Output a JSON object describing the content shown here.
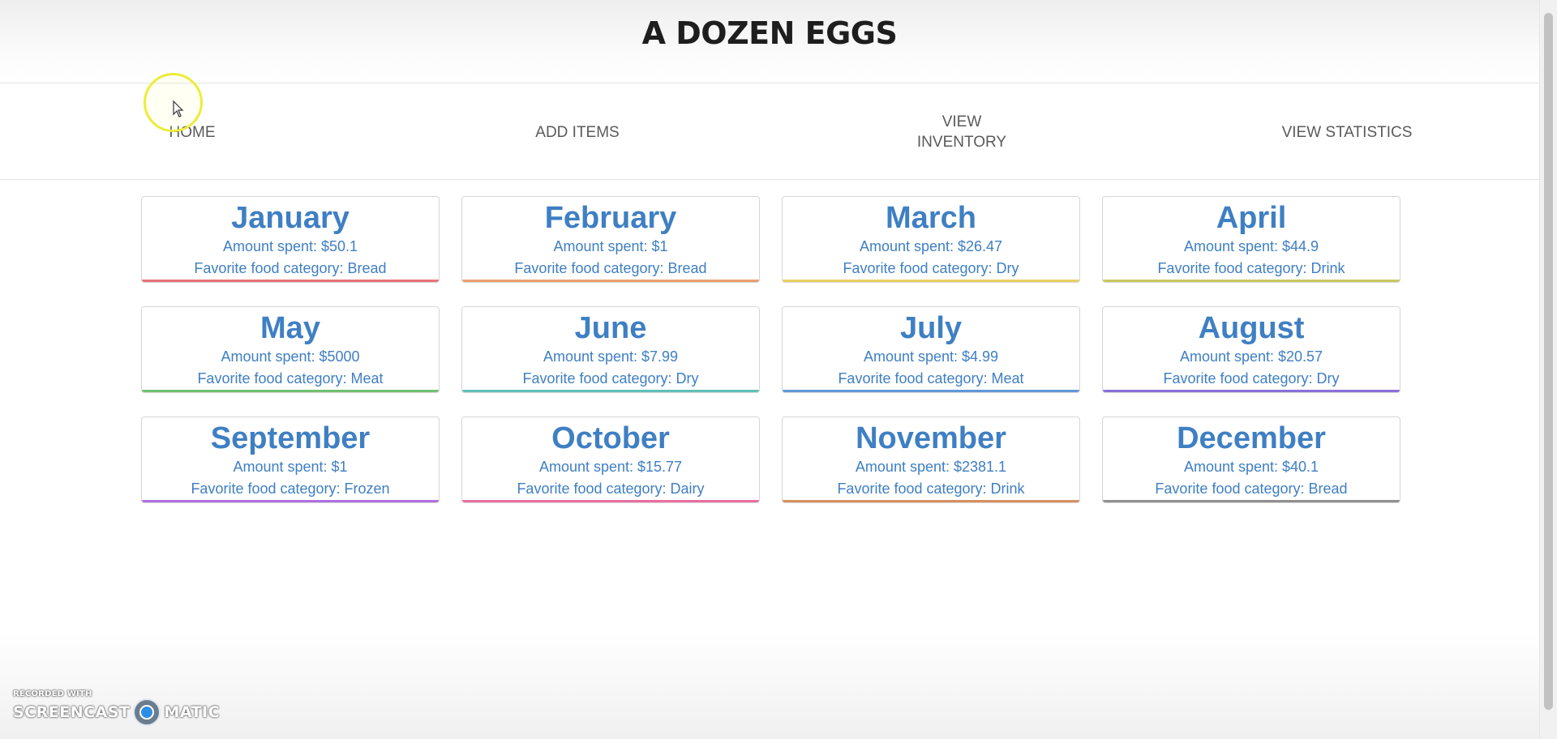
{
  "header": {
    "title": "A DOZEN EGGS"
  },
  "nav": {
    "home": "HOME",
    "add_items": "ADD ITEMS",
    "view_inventory": "VIEW INVENTORY",
    "view_statistics": "VIEW STATISTICS"
  },
  "months": [
    {
      "name": "January",
      "amount": "Amount spent: $50.1",
      "category": "Favorite food category: Bread",
      "accent": "#e8707a"
    },
    {
      "name": "February",
      "amount": "Amount spent: $1",
      "category": "Favorite food category: Bread",
      "accent": "#e8a070"
    },
    {
      "name": "March",
      "amount": "Amount spent: $26.47",
      "category": "Favorite food category: Dry",
      "accent": "#e8d060"
    },
    {
      "name": "April",
      "amount": "Amount spent: $44.9",
      "category": "Favorite food category: Drink",
      "accent": "#c8c860"
    },
    {
      "name": "May",
      "amount": "Amount spent: $5000",
      "category": "Favorite food category: Meat",
      "accent": "#70c070"
    },
    {
      "name": "June",
      "amount": "Amount spent: $7.99",
      "category": "Favorite food category: Dry",
      "accent": "#60c0b8"
    },
    {
      "name": "July",
      "amount": "Amount spent: $4.99",
      "category": "Favorite food category: Meat",
      "accent": "#6098d8"
    },
    {
      "name": "August",
      "amount": "Amount spent: $20.57",
      "category": "Favorite food category: Dry",
      "accent": "#8870d8"
    },
    {
      "name": "September",
      "amount": "Amount spent: $1",
      "category": "Favorite food category: Frozen",
      "accent": "#b070e0"
    },
    {
      "name": "October",
      "amount": "Amount spent: $15.77",
      "category": "Favorite food category: Dairy",
      "accent": "#e870a0"
    },
    {
      "name": "November",
      "amount": "Amount spent: $2381.1",
      "category": "Favorite food category: Drink",
      "accent": "#d89060"
    },
    {
      "name": "December",
      "amount": "Amount spent: $40.1",
      "category": "Favorite food category: Bread",
      "accent": "#909090"
    }
  ],
  "watermark": {
    "line1": "RECORDED WITH",
    "left": "SCREENCAST",
    "right": "MATIC"
  }
}
